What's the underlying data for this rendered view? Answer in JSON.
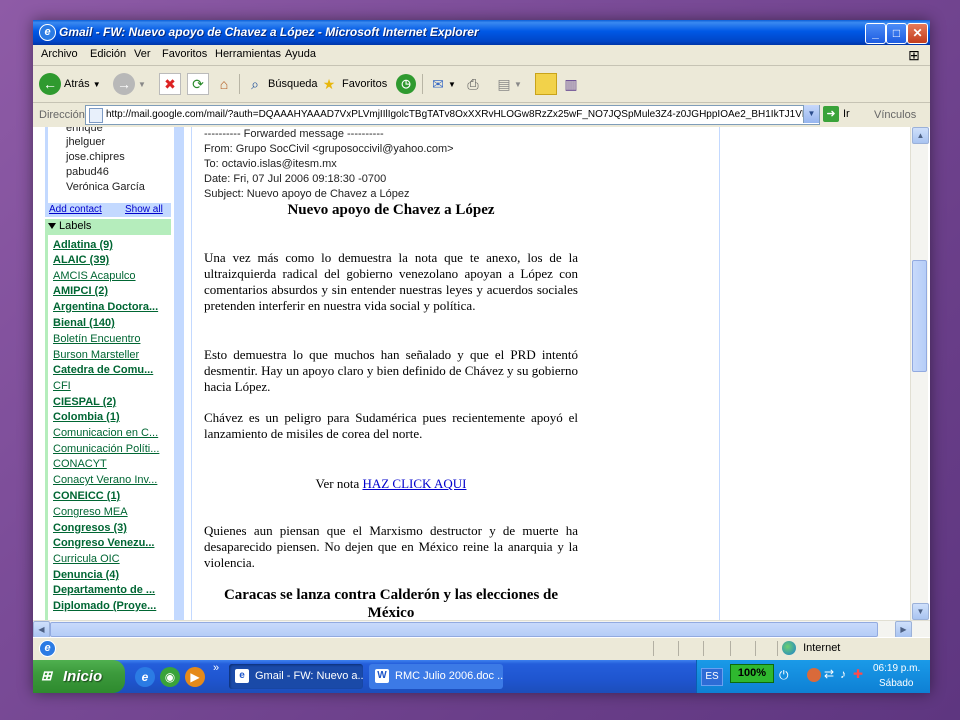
{
  "window": {
    "title": "Gmail - FW: Nuevo apoyo de Chavez a López - Microsoft Internet Explorer",
    "buttons": [
      "_",
      "□",
      "✕"
    ]
  },
  "menu": [
    "Archivo",
    "Edición",
    "Ver",
    "Favoritos",
    "Herramientas",
    "Ayuda"
  ],
  "toolbar": {
    "back": "Atrás",
    "search": "Búsqueda",
    "favorites": "Favoritos"
  },
  "address": {
    "label": "Dirección",
    "url": "http://mail.google.com/mail/?auth=DQAAAHYAAAD7VxPLVmjIIlIgolcTBgTATv8OxXXRvHLOGw8RzZx25wF_NO7JQSpMule3Z4-z0JGHppIOAe2_BH1IkTJ1VPGoAryWSb75",
    "go": "Ir",
    "links": "Vínculos"
  },
  "contacts": {
    "items": [
      "enrique",
      "jhelguer",
      "jose.chipres",
      "pabud46",
      "Verónica García"
    ],
    "add": "Add contact",
    "show_all": "Show all"
  },
  "labels": {
    "heading": "Labels",
    "items": [
      "Adlatina (9)",
      "ALAIC (39)",
      "AMCIS Acapulco",
      "AMIPCI (2)",
      "Argentina Doctora...",
      "Bienal (140)",
      "Boletín Encuentro",
      "Burson Marsteller",
      "Catedra de Comu...",
      "CFI",
      "CIESPAL (2)",
      "Colombia (1)",
      "Comunicacion en C...",
      "Comunicación Políti...",
      "CONACYT",
      "Conacyt Verano Inv...",
      "CONEICC (1)",
      "Congreso MEA",
      "Congresos (3)",
      "Congreso Venezu...",
      "Curricula OIC",
      "Denuncia (4)",
      "Departamento de ...",
      "Diplomado (Proye..."
    ]
  },
  "message": {
    "forwarded": "---------- Forwarded message ----------",
    "from": "From: Grupo SocCivil <gruposoccivil@yahoo.com>",
    "to": "To: octavio.islas@itesm.mx",
    "date": "Date: Fri, 07 Jul 2006 09:18:30 -0700",
    "subject": "Subject: Nuevo apoyo de Chavez a López",
    "title": "Nuevo apoyo de Chavez a López",
    "p1": "Una vez más como lo demuestra la nota que te anexo, los de la ultraizquierda radical del gobierno venezolano apoyan a López con comentarios absurdos y sin entender nuestras leyes y acuerdos sociales pretenden interferir en nuestra vida social y política.",
    "p2": "Esto demuestra lo que muchos han señalado y que el PRD intentó desmentir. Hay un apoyo claro y bien definido de Chávez y su gobierno hacia López.",
    "p3": "Chávez es un peligro para Sudamérica pues recientemente apoyó el lanzamiento de misiles de corea del norte.",
    "see_note": "Ver nota",
    "link": "HAZ CLICK AQUI",
    "p4": "Quienes aun piensan que el Marxismo destructor y de muerte ha desaparecido piensen. No dejen que en México reine la anarquia y la violencia.",
    "title2": "Caracas se lanza contra Calderón y las elecciones de México"
  },
  "status": {
    "zone": "Internet"
  },
  "taskbar": {
    "start": "Inicio",
    "tasks": [
      "Gmail - FW: Nuevo a...",
      "RMC Julio 2006.doc ..."
    ],
    "lang": "ES",
    "zoom": "100%",
    "time": "06:19 p.m.",
    "day": "Sábado"
  }
}
